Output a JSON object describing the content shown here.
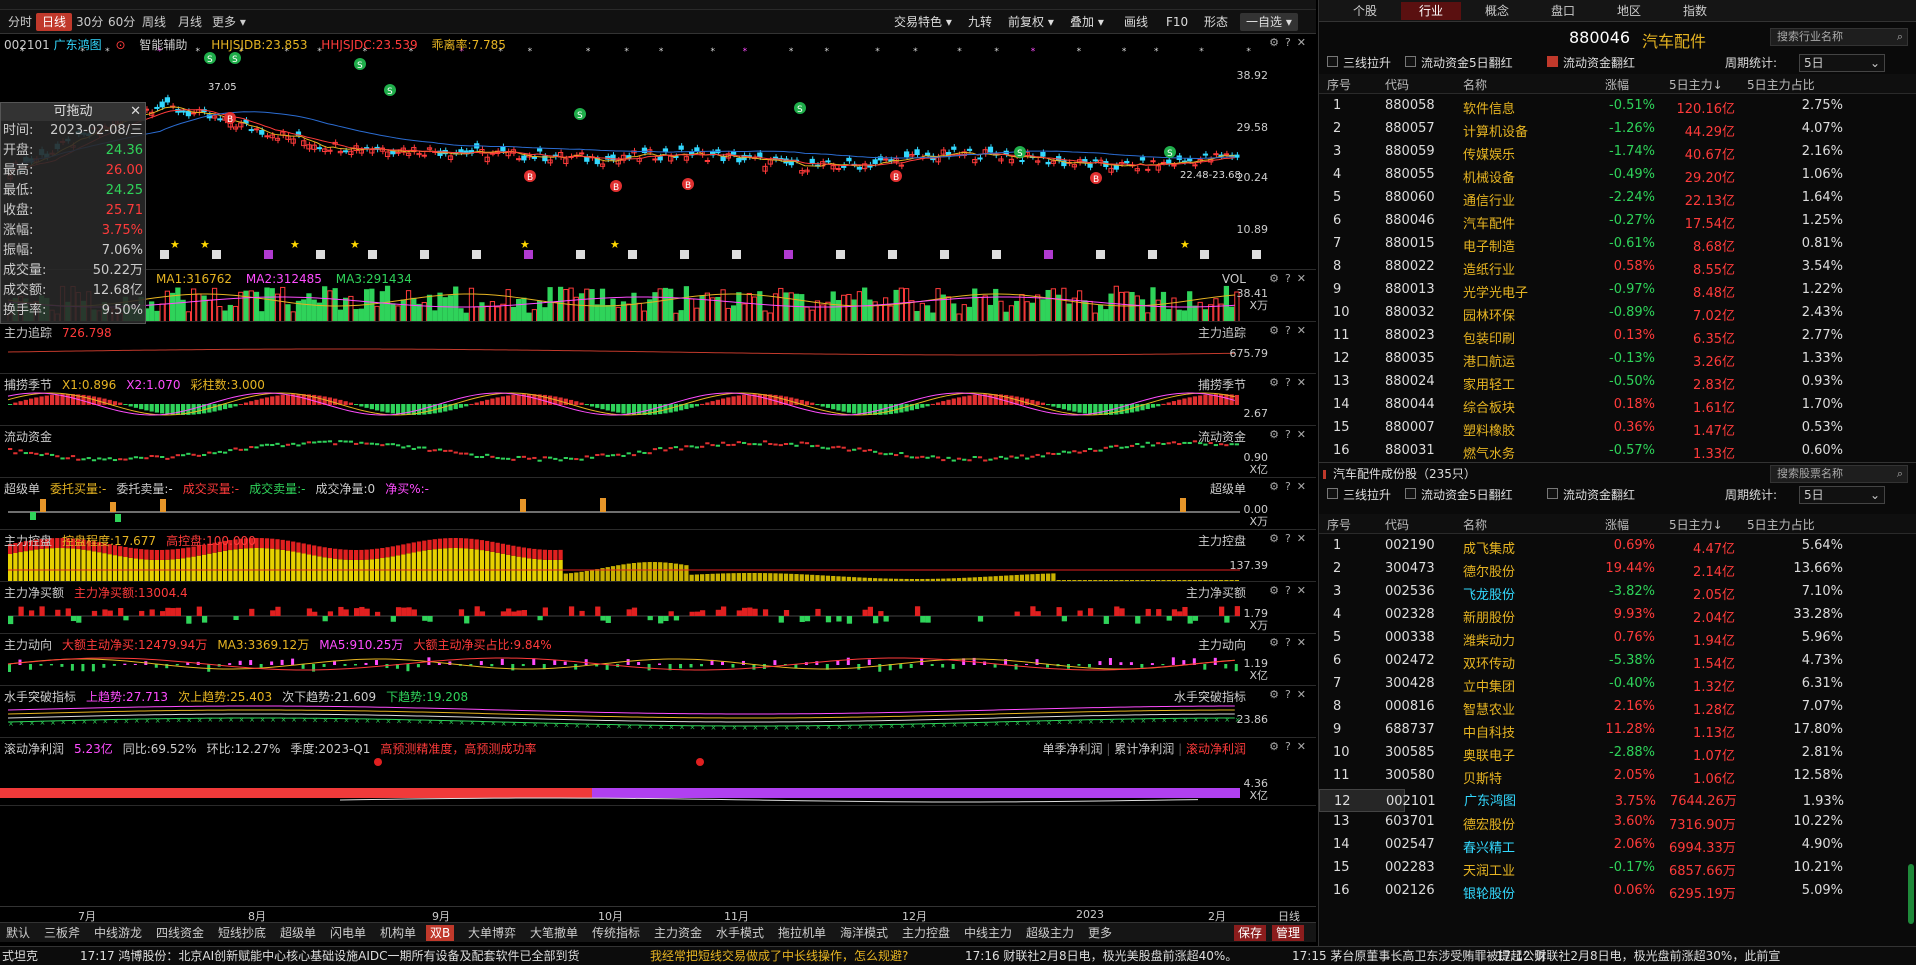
{
  "toolbar": {
    "left_tabs": [
      "分时",
      "日线",
      "30分",
      "60分",
      "周线",
      "月线",
      "更多"
    ],
    "right_buttons": [
      "交易特色",
      "九转",
      "前复权",
      "叠加",
      "画线",
      "F10",
      "形态",
      "一自选"
    ]
  },
  "stock": {
    "code": "002101",
    "name": "广东鸿图",
    "assist": "智能辅助"
  },
  "main_indicators": {
    "hhsjdb": "HHJSJDB:23.853",
    "hhsjdc": "HHJSJDC:23.539",
    "deviation": "乖离率:7.785"
  },
  "main_scale": [
    "38.92",
    "29.58",
    "20.24",
    "10.89"
  ],
  "price_marks": {
    "high": "37.05",
    "range": "22.48-23.68"
  },
  "infobox": {
    "title": "可拖动",
    "close": "✕",
    "rows": [
      {
        "label": "时间:",
        "value": "2023-02-08/三"
      },
      {
        "label": "开盘:",
        "value": "24.36"
      },
      {
        "label": "最高:",
        "value": "26.00"
      },
      {
        "label": "最低:",
        "value": "24.25"
      },
      {
        "label": "收盘:",
        "value": "25.71"
      },
      {
        "label": "涨幅:",
        "value": "3.75%"
      },
      {
        "label": "振幅:",
        "value": "7.06%"
      },
      {
        "label": "成交量:",
        "value": "50.22万"
      },
      {
        "label": "成交额:",
        "value": "12.68亿"
      },
      {
        "label": "换手率:",
        "value": "9.50%"
      }
    ]
  },
  "panels": {
    "vol": {
      "title": "VOL",
      "ma1": "MA1:316762",
      "ma2": "MA2:312485",
      "ma3": "MA3:291434",
      "scale": [
        "38.41",
        "X万"
      ]
    },
    "zlzz": {
      "title": "主力追踪",
      "value": "726.798",
      "rtitle": "主力追踪",
      "scale": [
        "675.79"
      ]
    },
    "blj": {
      "title": "捕捞季节",
      "x1": "X1:0.896",
      "x2": "X2:1.070",
      "cz": "彩柱数:3.000",
      "rtitle": "捕捞季节",
      "scale": [
        "2.67"
      ]
    },
    "ldzj": {
      "title": "流动资金",
      "rtitle": "流动资金",
      "scale": [
        "0.90",
        "X亿"
      ]
    },
    "cjd": {
      "title": "超级单",
      "wtmr": "委托买量:-",
      "wtmc": "委托卖量:-",
      "cjmr": "成交买量:-",
      "cjmc": "成交卖量:-",
      "cjjl": "成交净量:0",
      "jm": "净买%:-",
      "rtitle": "超级单",
      "scale": [
        "0.00",
        "X万"
      ]
    },
    "zlkp": {
      "title": "主力控盘",
      "kpcd": "控盘程度:17.677",
      "gkp": "高控盘:100.000",
      "rtitle": "主力控盘",
      "scale": [
        "137.39"
      ]
    },
    "zljme": {
      "title": "主力净买额",
      "val": "主力净买额:13004.4",
      "rtitle": "主力净买额",
      "scale": [
        "1.79",
        "X万"
      ]
    },
    "zldx": {
      "title": "主力动向",
      "d1": "大额主动净买:12479.94万",
      "ma3": "MA3:3369.12万",
      "ma5": "MA5:910.25万",
      "d2": "大额主动净买占比:9.84%",
      "rtitle": "主力动向",
      "scale": [
        "1.19",
        "X亿"
      ]
    },
    "sstp": {
      "title": "水手突破指标",
      "s1": "上趋势:27.713",
      "s2": "次上趋势:25.403",
      "s3": "次下趋势:21.609",
      "s4": "下趋势:19.208",
      "rtitle": "水手突破指标",
      "scale": [
        "23.86"
      ]
    },
    "gdjlr": {
      "title": "滚动净利润",
      "v": "5.23亿",
      "tb": "同比:69.52%",
      "hb": "环比:12.27%",
      "jd": "季度:2023-Q1",
      "warn": "高预测精准度，高预测成功率",
      "opts": [
        "单季净利润",
        "累计净利润",
        "滚动净利润"
      ],
      "scale": [
        "4.36",
        "X亿"
      ]
    }
  },
  "xaxis": [
    "7月",
    "8月",
    "9月",
    "10月",
    "11月",
    "12月",
    "2023",
    "2月"
  ],
  "xaxis_right": "日线",
  "bottom_tabs": [
    "默认",
    "三板斧",
    "中线游龙",
    "四线资金",
    "短线抄底",
    "超级单",
    "闪电单",
    "机构单",
    "双B",
    "大单博弈",
    "大笔撤单",
    "传统指标",
    "主力资金",
    "水手模式",
    "拖拉机单",
    "海洋模式",
    "主力控盘",
    "中线主力",
    "超级主力",
    "更多",
    "保存",
    "管理"
  ],
  "ticker": [
    "式坦克",
    "17:17 鸿博股份：北京AI创新赋能中心核心基础设施AIDC一期所有设备及配套软件已全部到货",
    "我经常把短线交易做成了中长线操作，怎么规避?",
    "17:16 财联社2月8日电，极光美股盘前涨超40%。",
    "17:15 茅台原董事长高卫东涉受贿罪被提起公诉",
    "17:12 财联社2月8日电，极光盘前涨超30%，此前宣"
  ],
  "right": {
    "tabs": [
      "个股",
      "行业",
      "概念",
      "盘口",
      "地区",
      "指数"
    ],
    "sector_code": "880046",
    "sector_name": "汽车配件",
    "search1": "搜索行业名称",
    "filters": [
      "三线拉升",
      "流动资金5日翻红",
      "流动资金翻红"
    ],
    "period_label": "周期统计:",
    "period": "5日",
    "headers": [
      "序号",
      "代码",
      "名称",
      "涨幅",
      "5日主力↓",
      "5日主力占比"
    ],
    "industries": [
      [
        "1",
        "880058",
        "软件信息",
        "-0.51%",
        "120.16亿",
        "2.75%"
      ],
      [
        "2",
        "880057",
        "计算机设备",
        "-1.26%",
        "44.29亿",
        "4.07%"
      ],
      [
        "3",
        "880059",
        "传媒娱乐",
        "-1.74%",
        "40.67亿",
        "2.16%"
      ],
      [
        "4",
        "880055",
        "机械设备",
        "-0.49%",
        "29.20亿",
        "1.06%"
      ],
      [
        "5",
        "880060",
        "通信行业",
        "-2.24%",
        "22.13亿",
        "1.64%"
      ],
      [
        "6",
        "880046",
        "汽车配件",
        "-0.27%",
        "17.54亿",
        "1.25%"
      ],
      [
        "7",
        "880015",
        "电子制造",
        "-0.61%",
        "8.68亿",
        "0.81%"
      ],
      [
        "8",
        "880022",
        "造纸行业",
        "0.58%",
        "8.55亿",
        "3.54%"
      ],
      [
        "9",
        "880013",
        "光学光电子",
        "-0.97%",
        "8.48亿",
        "1.22%"
      ],
      [
        "10",
        "880032",
        "园林环保",
        "-0.89%",
        "7.02亿",
        "2.43%"
      ],
      [
        "11",
        "880023",
        "包装印刷",
        "0.13%",
        "6.35亿",
        "2.77%"
      ],
      [
        "12",
        "880035",
        "港口航运",
        "-0.13%",
        "3.26亿",
        "1.33%"
      ],
      [
        "13",
        "880024",
        "家用轻工",
        "-0.50%",
        "2.83亿",
        "0.93%"
      ],
      [
        "14",
        "880044",
        "综合板块",
        "0.18%",
        "1.61亿",
        "1.70%"
      ],
      [
        "15",
        "880007",
        "塑料橡胶",
        "0.36%",
        "1.47亿",
        "0.53%"
      ],
      [
        "16",
        "880031",
        "燃气水务",
        "-0.57%",
        "1.33亿",
        "0.60%"
      ]
    ],
    "comp_title": "汽车配件成份股（235只）",
    "search2": "搜索股票名称",
    "filters2": [
      "三线拉升",
      "流动资金5日翻红",
      "流动资金翻红"
    ],
    "stocks": [
      [
        "1",
        "002190",
        "成飞集成",
        "0.69%",
        "4.47亿",
        "5.64%"
      ],
      [
        "2",
        "300473",
        "德尔股份",
        "19.44%",
        "2.14亿",
        "13.66%"
      ],
      [
        "3",
        "002536",
        "飞龙股份",
        "-3.82%",
        "2.05亿",
        "7.10%"
      ],
      [
        "4",
        "002328",
        "新朋股份",
        "9.93%",
        "2.04亿",
        "33.28%"
      ],
      [
        "5",
        "000338",
        "潍柴动力",
        "0.76%",
        "1.94亿",
        "5.96%"
      ],
      [
        "6",
        "002472",
        "双环传动",
        "-5.38%",
        "1.54亿",
        "4.73%"
      ],
      [
        "7",
        "300428",
        "立中集团",
        "-0.40%",
        "1.32亿",
        "6.31%"
      ],
      [
        "8",
        "000816",
        "智慧农业",
        "2.16%",
        "1.28亿",
        "7.07%"
      ],
      [
        "9",
        "688737",
        "中自科技",
        "11.28%",
        "1.13亿",
        "17.80%"
      ],
      [
        "10",
        "300585",
        "奥联电子",
        "-2.88%",
        "1.07亿",
        "2.81%"
      ],
      [
        "11",
        "300580",
        "贝斯特",
        "2.05%",
        "1.06亿",
        "12.58%"
      ],
      [
        "12",
        "002101",
        "广东鸿图",
        "3.75%",
        "7644.26万",
        "1.93%"
      ],
      [
        "13",
        "603701",
        "德宏股份",
        "3.60%",
        "7316.90万",
        "10.22%"
      ],
      [
        "14",
        "002547",
        "春兴精工",
        "2.06%",
        "6994.33万",
        "4.90%"
      ],
      [
        "15",
        "002283",
        "天润工业",
        "-0.17%",
        "6857.66万",
        "10.21%"
      ],
      [
        "16",
        "002126",
        "银轮股份",
        "0.06%",
        "6295.19万",
        "5.09%"
      ]
    ],
    "colors": {
      "up": "#ff3b3b",
      "down": "#2fd35a",
      "sector": "#e6b422",
      "highlight": "#33d9ff"
    }
  }
}
